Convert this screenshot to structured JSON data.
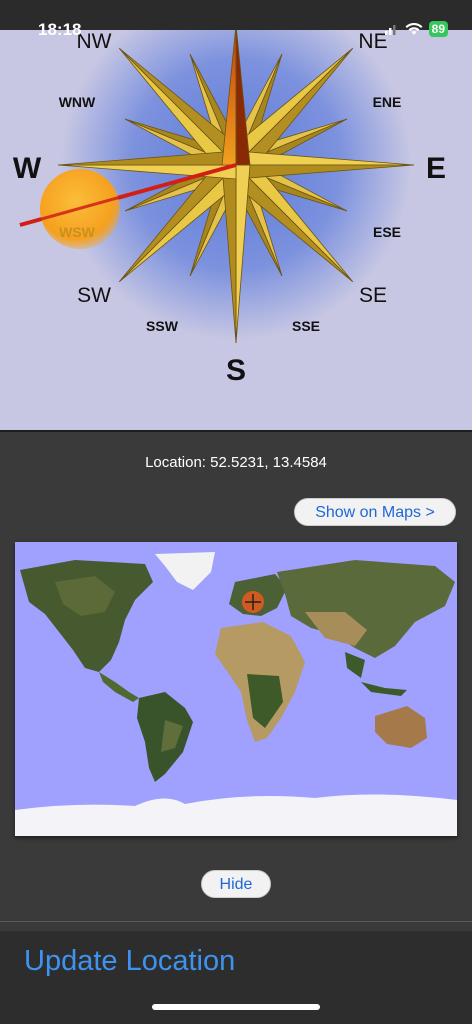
{
  "status": {
    "time": "18:18",
    "battery": "89"
  },
  "compass": {
    "directions": {
      "N": "",
      "NE": "NE",
      "ENE": "ENE",
      "E": "E",
      "ESE": "ESE",
      "SE": "SE",
      "SSE": "SSE",
      "S": "S",
      "SSW": "SSW",
      "SW": "SW",
      "WSW": "WSW",
      "W": "W",
      "WNW": "WNW",
      "NW": "NW"
    },
    "colors": {
      "background": "#c7c7e3",
      "glow": "#6f86d8",
      "star": "#d8b43a",
      "needle_north": "#d95b0b",
      "sun": "#f7a21f",
      "sun_line": "#d11f16"
    }
  },
  "location": {
    "text": "Location:  52.5231,  13.4584"
  },
  "buttons": {
    "show_on_maps": "Show on Maps >",
    "hide": "Hide",
    "update_location": "Update Location"
  },
  "map": {
    "ocean_color": "#a0a0ff",
    "marker_icon": "crosshair-pin-icon"
  }
}
